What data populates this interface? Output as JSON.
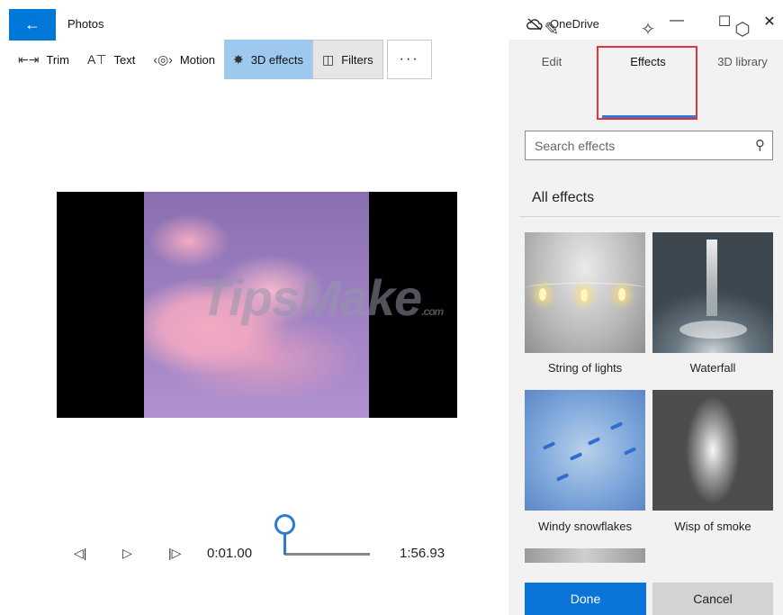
{
  "window": {
    "title": "Photos",
    "onedrive_label": "OneDrive",
    "back_icon": "back-arrow-icon"
  },
  "toolbar": {
    "trim": "Trim",
    "text": "Text",
    "motion": "Motion",
    "effects_3d": "3D effects",
    "filters": "Filters",
    "more": "···"
  },
  "playback": {
    "current_time": "0:01.00",
    "total_time": "1:56.93"
  },
  "watermark": {
    "text": "TipsMake",
    "suffix": ".com"
  },
  "panel": {
    "tabs": [
      {
        "label": "Edit",
        "icon": "pencil-icon"
      },
      {
        "label": "Effects",
        "icon": "sparkle-icon"
      },
      {
        "label": "3D library",
        "icon": "cube-library-icon"
      }
    ],
    "active_tab": "Effects",
    "search_placeholder": "Search effects",
    "section_title": "All effects",
    "effects": [
      {
        "label": "String of lights"
      },
      {
        "label": "Waterfall"
      },
      {
        "label": "Windy snowflakes"
      },
      {
        "label": "Wisp of smoke"
      }
    ],
    "done_label": "Done",
    "cancel_label": "Cancel"
  },
  "colors": {
    "accent": "#0078d7",
    "active_tool": "#9dc9ef",
    "highlight_border": "#e0343a"
  }
}
